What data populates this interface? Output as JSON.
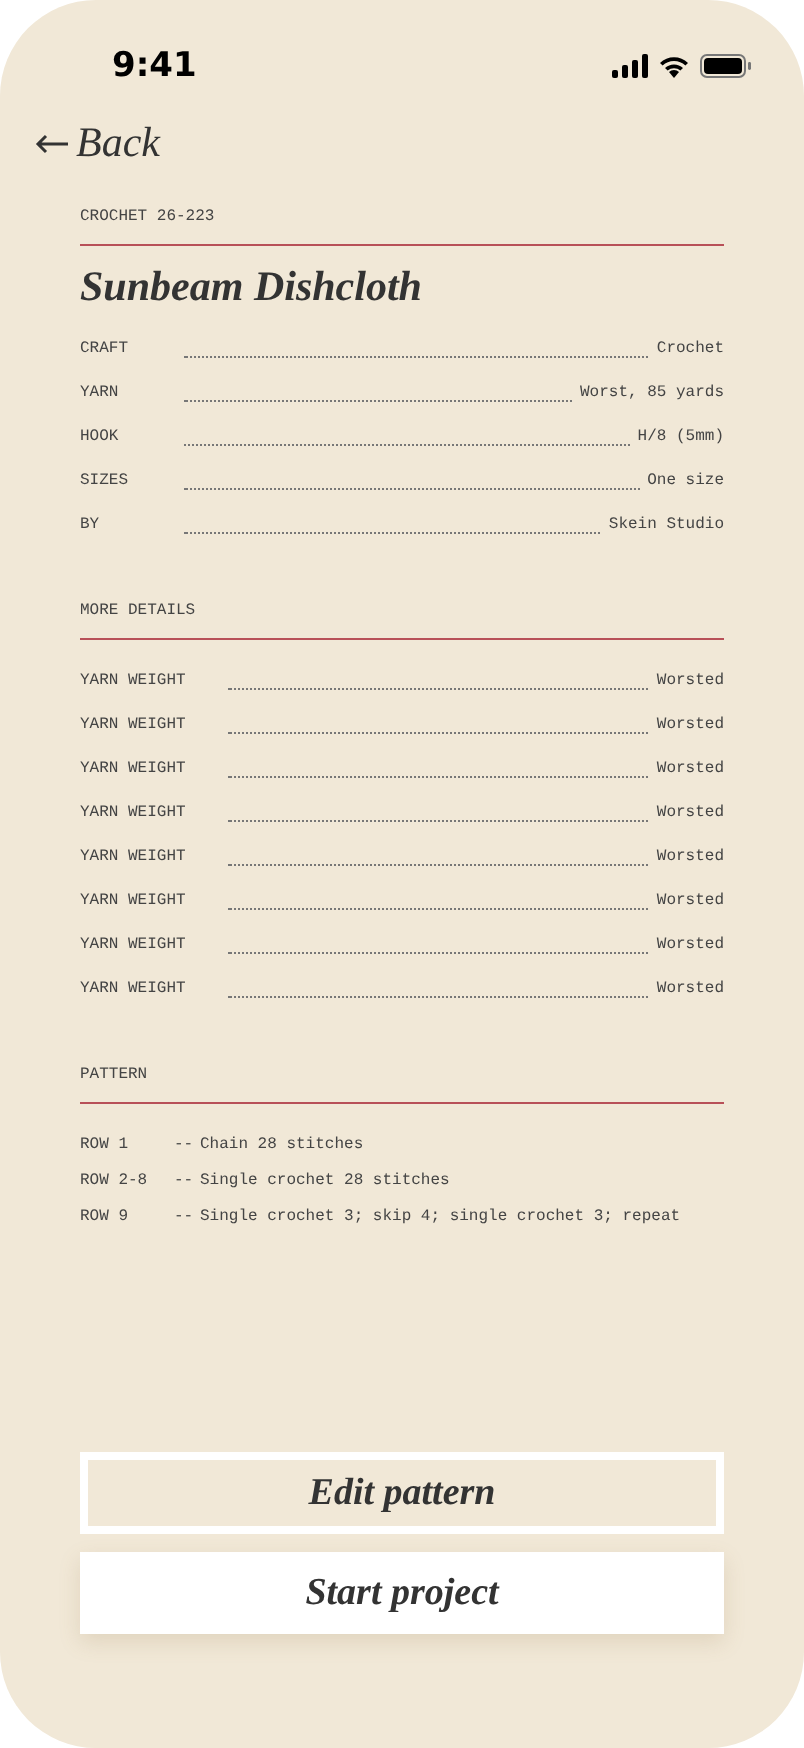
{
  "status_bar": {
    "time": "9:41"
  },
  "nav": {
    "back": "Back"
  },
  "header": {
    "code": "CROCHET 26-223",
    "title": "Sunbeam Dishcloth"
  },
  "specs": [
    {
      "label": "CRAFT",
      "value": "Crochet"
    },
    {
      "label": "YARN",
      "value": "Worst, 85 yards"
    },
    {
      "label": "HOOK",
      "value": "H/8 (5mm)"
    },
    {
      "label": "SIZES",
      "value": "One size"
    },
    {
      "label": "BY",
      "value": "Skein Studio"
    }
  ],
  "more_details": {
    "heading": "MORE DETAILS",
    "rows": [
      {
        "label": "YARN WEIGHT",
        "value": "Worsted"
      },
      {
        "label": "YARN WEIGHT",
        "value": "Worsted"
      },
      {
        "label": "YARN WEIGHT",
        "value": "Worsted"
      },
      {
        "label": "YARN WEIGHT",
        "value": "Worsted"
      },
      {
        "label": "YARN WEIGHT",
        "value": "Worsted"
      },
      {
        "label": "YARN WEIGHT",
        "value": "Worsted"
      },
      {
        "label": "YARN WEIGHT",
        "value": "Worsted"
      },
      {
        "label": "YARN WEIGHT",
        "value": "Worsted"
      }
    ]
  },
  "pattern": {
    "heading": "PATTERN",
    "rows": [
      {
        "label": "ROW 1",
        "separator": "--",
        "text": "Chain 28 stitches"
      },
      {
        "label": "ROW 2-8",
        "separator": "--",
        "text": "Single crochet 28 stitches"
      },
      {
        "label": "ROW 9",
        "separator": "--",
        "text": "Single crochet 3; skip 4; single crochet 3; repeat"
      }
    ]
  },
  "buttons": [
    {
      "label": "Edit pattern",
      "kind": "outline"
    },
    {
      "label": "Start project",
      "kind": "filled"
    }
  ]
}
